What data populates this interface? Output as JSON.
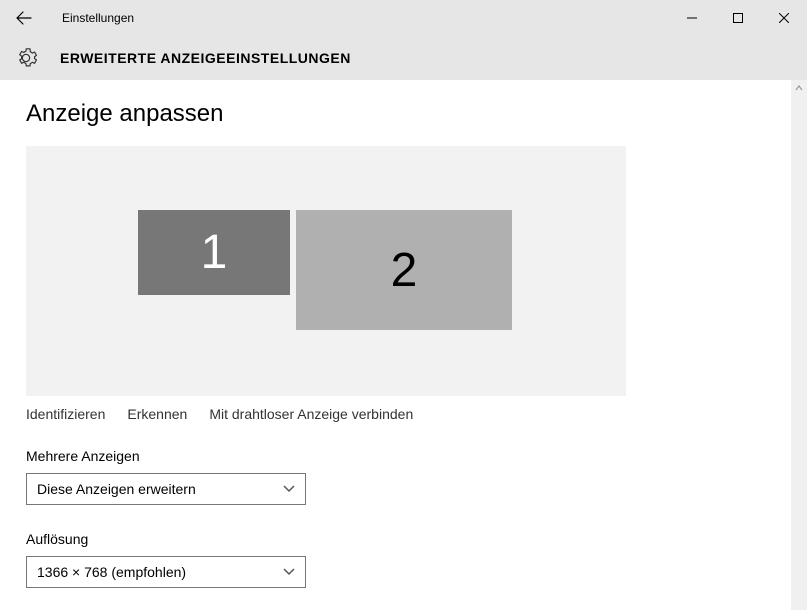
{
  "window": {
    "title": "Einstellungen"
  },
  "header": {
    "title": "ERWEITERTE ANZEIGEEINSTELLUNGEN"
  },
  "main": {
    "heading": "Anzeige anpassen",
    "monitors": {
      "m1": "1",
      "m2": "2"
    },
    "links": {
      "identify": "Identifizieren",
      "detect": "Erkennen",
      "wireless": "Mit drahtloser Anzeige verbinden"
    },
    "multiple": {
      "label": "Mehrere Anzeigen",
      "value": "Diese Anzeigen erweitern"
    },
    "resolution": {
      "label": "Auflösung",
      "value": "1366 × 768 (empfohlen)"
    }
  }
}
